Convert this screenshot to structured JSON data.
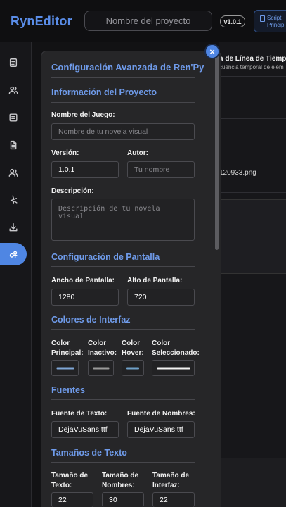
{
  "header": {
    "brand": "RynEditor",
    "project_name": "Nombre del proyecto",
    "version": "v1.0.1",
    "script_button": [
      "Script",
      "Princip"
    ]
  },
  "sidebar": {
    "items": [
      {
        "icon": "document-icon",
        "active": false
      },
      {
        "icon": "users-icon",
        "active": false
      },
      {
        "icon": "note-icon",
        "active": false
      },
      {
        "icon": "file-icon",
        "active": false
      },
      {
        "icon": "group-icon",
        "active": false
      },
      {
        "icon": "sparkle-icon",
        "active": false
      },
      {
        "icon": "download-icon",
        "active": false
      },
      {
        "icon": "settings-icon",
        "active": true
      }
    ]
  },
  "background": {
    "title": "a de Línea de Tiemp",
    "subtitle": "cuencia temporal de elem",
    "file": "120933.png"
  },
  "panel": {
    "title": "Configuración Avanzada de Ren'Py",
    "close": "×",
    "project_info": {
      "heading": "Información del Proyecto",
      "game_name_label": "Nombre del Juego:",
      "game_name_placeholder": "Nombre de tu novela visual",
      "version_label": "Versión:",
      "version_value": "1.0.1",
      "author_label": "Autor:",
      "author_placeholder": "Tu nombre",
      "description_label": "Descripción:",
      "description_placeholder": "Descripción de tu novela visual"
    },
    "screen": {
      "heading": "Configuración de Pantalla",
      "width_label": "Ancho de Pantalla:",
      "width_value": "1280",
      "height_label": "Alto de Pantalla:",
      "height_value": "720"
    },
    "colors": {
      "heading": "Colores de Interfaz",
      "items": [
        {
          "label": "Color Principal:",
          "swatch": "#7fa6d6"
        },
        {
          "label": "Color Inactivo:",
          "swatch": "#9a9a9a"
        },
        {
          "label": "Color Hover:",
          "swatch": "#6fa0c8"
        },
        {
          "label": "Color Seleccionado:",
          "swatch": "#f2f2f2"
        }
      ]
    },
    "fonts": {
      "heading": "Fuentes",
      "text_font_label": "Fuente de Texto:",
      "text_font_value": "DejaVuSans.ttf",
      "name_font_label": "Fuente de Nombres:",
      "name_font_value": "DejaVuSans.ttf"
    },
    "sizes": {
      "heading": "Tamaños de Texto",
      "text_size_label": "Tamaño de Texto:",
      "text_size_value": "22",
      "name_size_label": "Tamaño de Nombres:",
      "name_size_value": "30",
      "ui_size_label": "Tamaño de Interfaz:",
      "ui_size_value": "22"
    }
  },
  "colors": {
    "accent": "#4f86e3",
    "heading": "#6f9bea",
    "background": "#121214"
  }
}
